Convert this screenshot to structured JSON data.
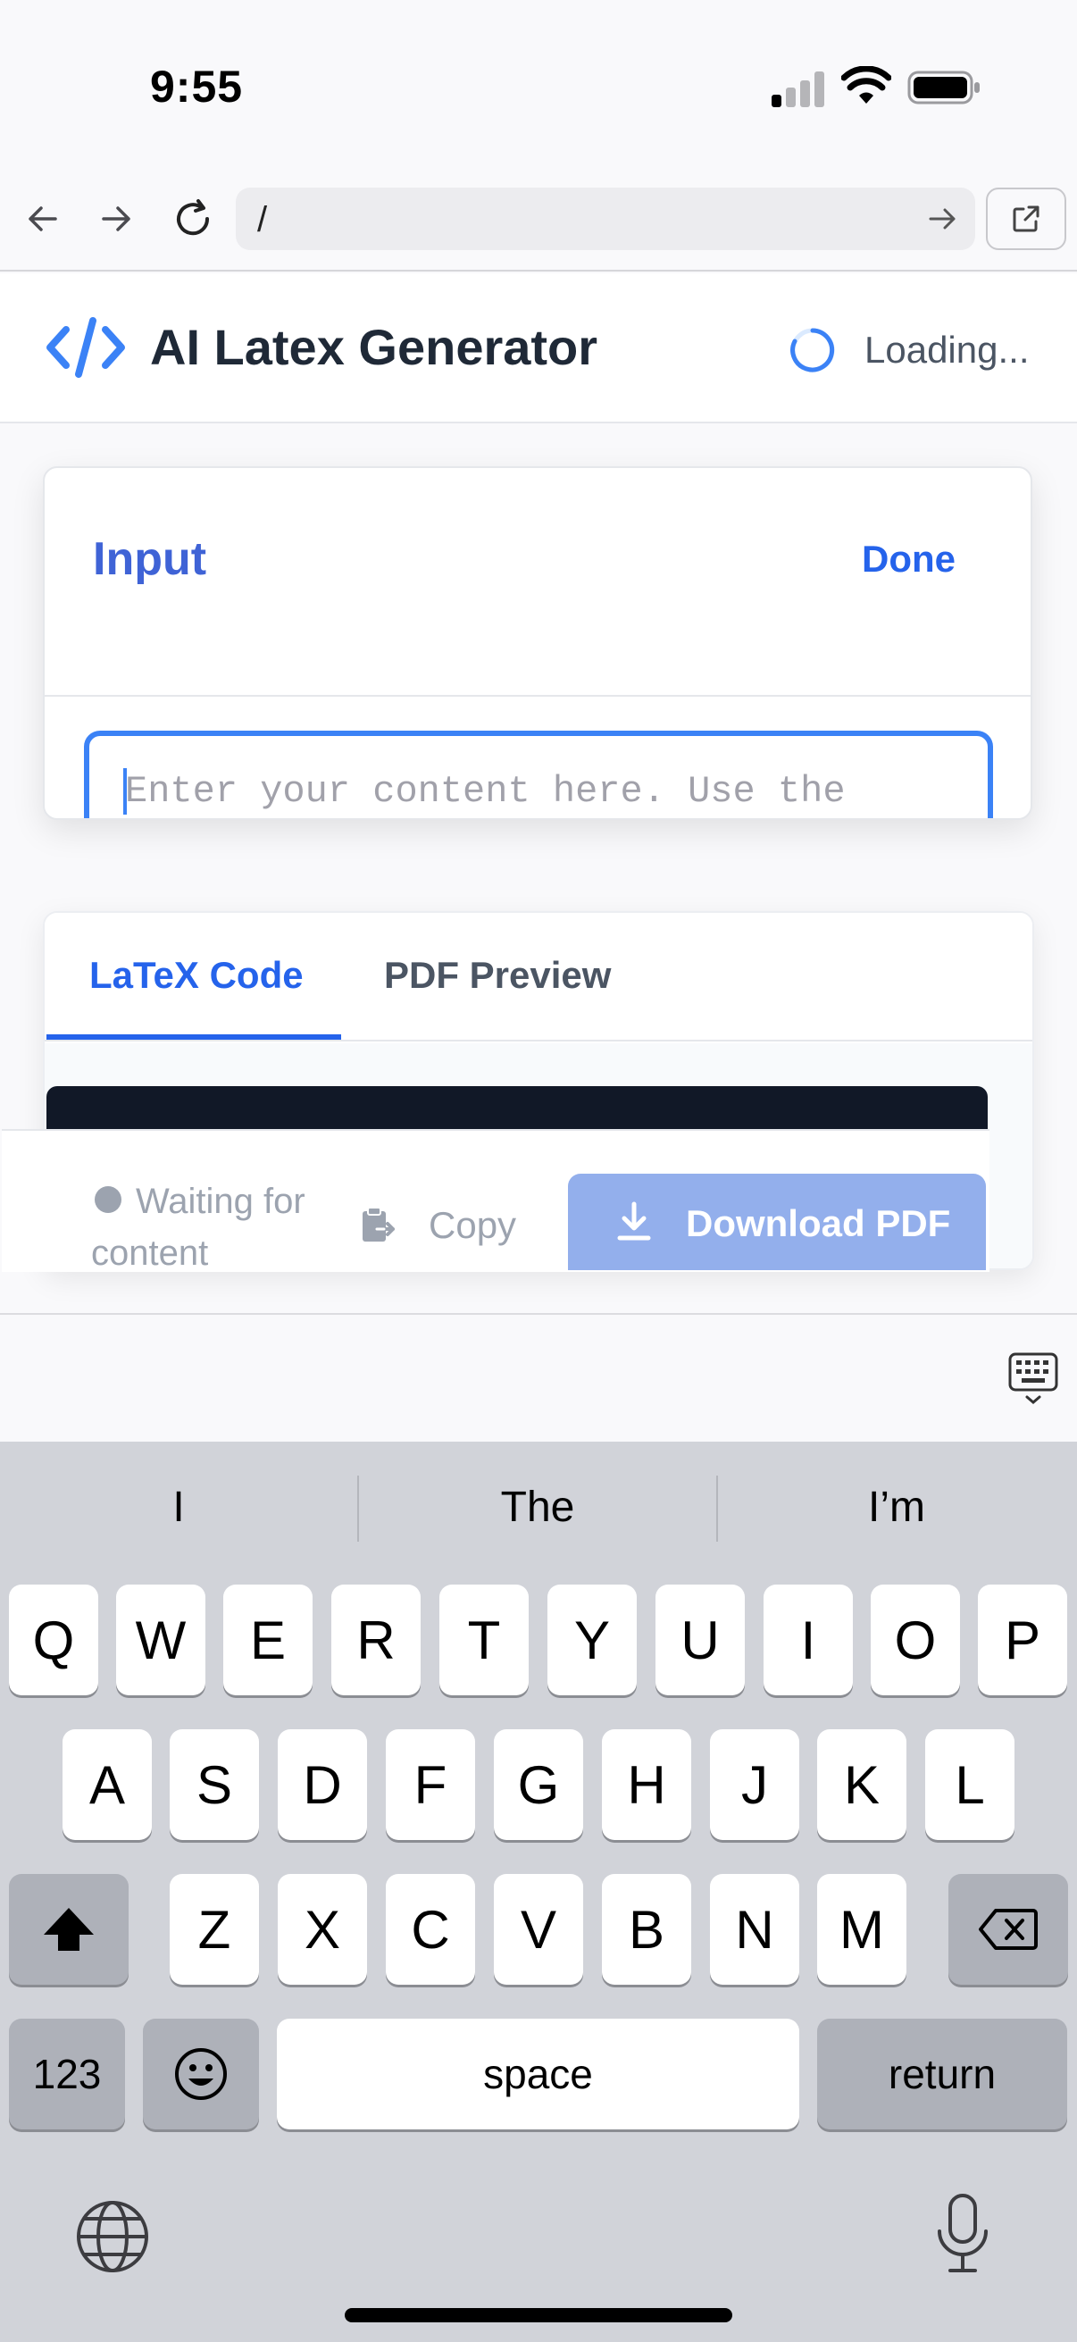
{
  "status_bar": {
    "time": "9:55"
  },
  "browser": {
    "url": "/"
  },
  "header": {
    "title": "AI Latex Generator",
    "loading_text": "Loading..."
  },
  "input_card": {
    "title": "Input",
    "done_label": "Done",
    "placeholder": "Enter your content here. Use the"
  },
  "output_card": {
    "tabs": [
      {
        "label": "LaTeX Code",
        "active": true
      },
      {
        "label": "PDF Preview",
        "active": false
      }
    ],
    "status_text": "Waiting for content",
    "copy_label": "Copy",
    "download_label": "Download PDF"
  },
  "keyboard": {
    "suggestions": [
      "I",
      "The",
      "I’m"
    ],
    "row1": [
      "Q",
      "W",
      "E",
      "R",
      "T",
      "Y",
      "U",
      "I",
      "O",
      "P"
    ],
    "row2": [
      "A",
      "S",
      "D",
      "F",
      "G",
      "H",
      "J",
      "K",
      "L"
    ],
    "row3": [
      "Z",
      "X",
      "C",
      "V",
      "B",
      "N",
      "M"
    ],
    "numbers_label": "123",
    "space_label": "space",
    "return_label": "return"
  },
  "colors": {
    "accent": "#2563eb",
    "focus_border": "#3b82f6",
    "download_disabled": "#93afec",
    "code_bg": "#111827"
  }
}
